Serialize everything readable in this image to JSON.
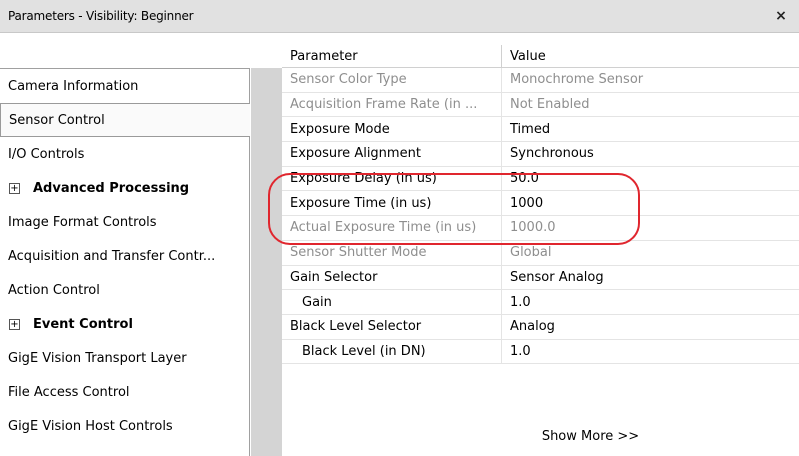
{
  "window": {
    "title": "Parameters - Visibility: Beginner",
    "close_glyph": "×"
  },
  "sidebar": {
    "items": [
      {
        "label": "Camera Information",
        "expandable": false,
        "bold": false,
        "selected": false
      },
      {
        "label": "Sensor Control",
        "expandable": false,
        "bold": false,
        "selected": true
      },
      {
        "label": "I/O Controls",
        "expandable": false,
        "bold": false,
        "selected": false
      },
      {
        "label": "Advanced Processing",
        "expandable": true,
        "bold": true,
        "selected": false
      },
      {
        "label": "Image Format Controls",
        "expandable": false,
        "bold": false,
        "selected": false
      },
      {
        "label": "Acquisition and Transfer Contr...",
        "expandable": false,
        "bold": false,
        "selected": false
      },
      {
        "label": "Action Control",
        "expandable": false,
        "bold": false,
        "selected": false
      },
      {
        "label": "Event Control",
        "expandable": true,
        "bold": true,
        "selected": false
      },
      {
        "label": "GigE Vision Transport Layer",
        "expandable": false,
        "bold": false,
        "selected": false
      },
      {
        "label": "File Access Control",
        "expandable": false,
        "bold": false,
        "selected": false
      },
      {
        "label": "GigE Vision Host Controls",
        "expandable": false,
        "bold": false,
        "selected": false
      }
    ],
    "expand_glyph": "+"
  },
  "grid": {
    "columns": {
      "param": "Parameter",
      "value": "Value"
    },
    "rows": [
      {
        "param": "Sensor Color Type",
        "value": "Monochrome Sensor",
        "enabled": false,
        "indent": false
      },
      {
        "param": "Acquisition Frame Rate (in ...",
        "value": "Not Enabled",
        "enabled": false,
        "indent": false
      },
      {
        "param": "Exposure Mode",
        "value": "Timed",
        "enabled": true,
        "indent": false
      },
      {
        "param": "Exposure Alignment",
        "value": "Synchronous",
        "enabled": true,
        "indent": false
      },
      {
        "param": "Exposure Delay (in us)",
        "value": "50.0",
        "enabled": true,
        "indent": false
      },
      {
        "param": "Exposure Time (in us)",
        "value": "1000",
        "enabled": true,
        "indent": false
      },
      {
        "param": "Actual Exposure Time (in us)",
        "value": "1000.0",
        "enabled": false,
        "indent": false
      },
      {
        "param": "Sensor Shutter Mode",
        "value": "Global",
        "enabled": false,
        "indent": false
      },
      {
        "param": "Gain Selector",
        "value": "Sensor Analog",
        "enabled": true,
        "indent": false
      },
      {
        "param": "Gain",
        "value": "1.0",
        "enabled": true,
        "indent": true
      },
      {
        "param": "Black Level Selector",
        "value": "Analog",
        "enabled": true,
        "indent": false
      },
      {
        "param": "Black Level (in DN)",
        "value": "1.0",
        "enabled": true,
        "indent": true
      }
    ],
    "show_more": "Show More >>"
  },
  "colors": {
    "highlight": "#e0262e",
    "disabled_text": "#8e8e8e"
  }
}
